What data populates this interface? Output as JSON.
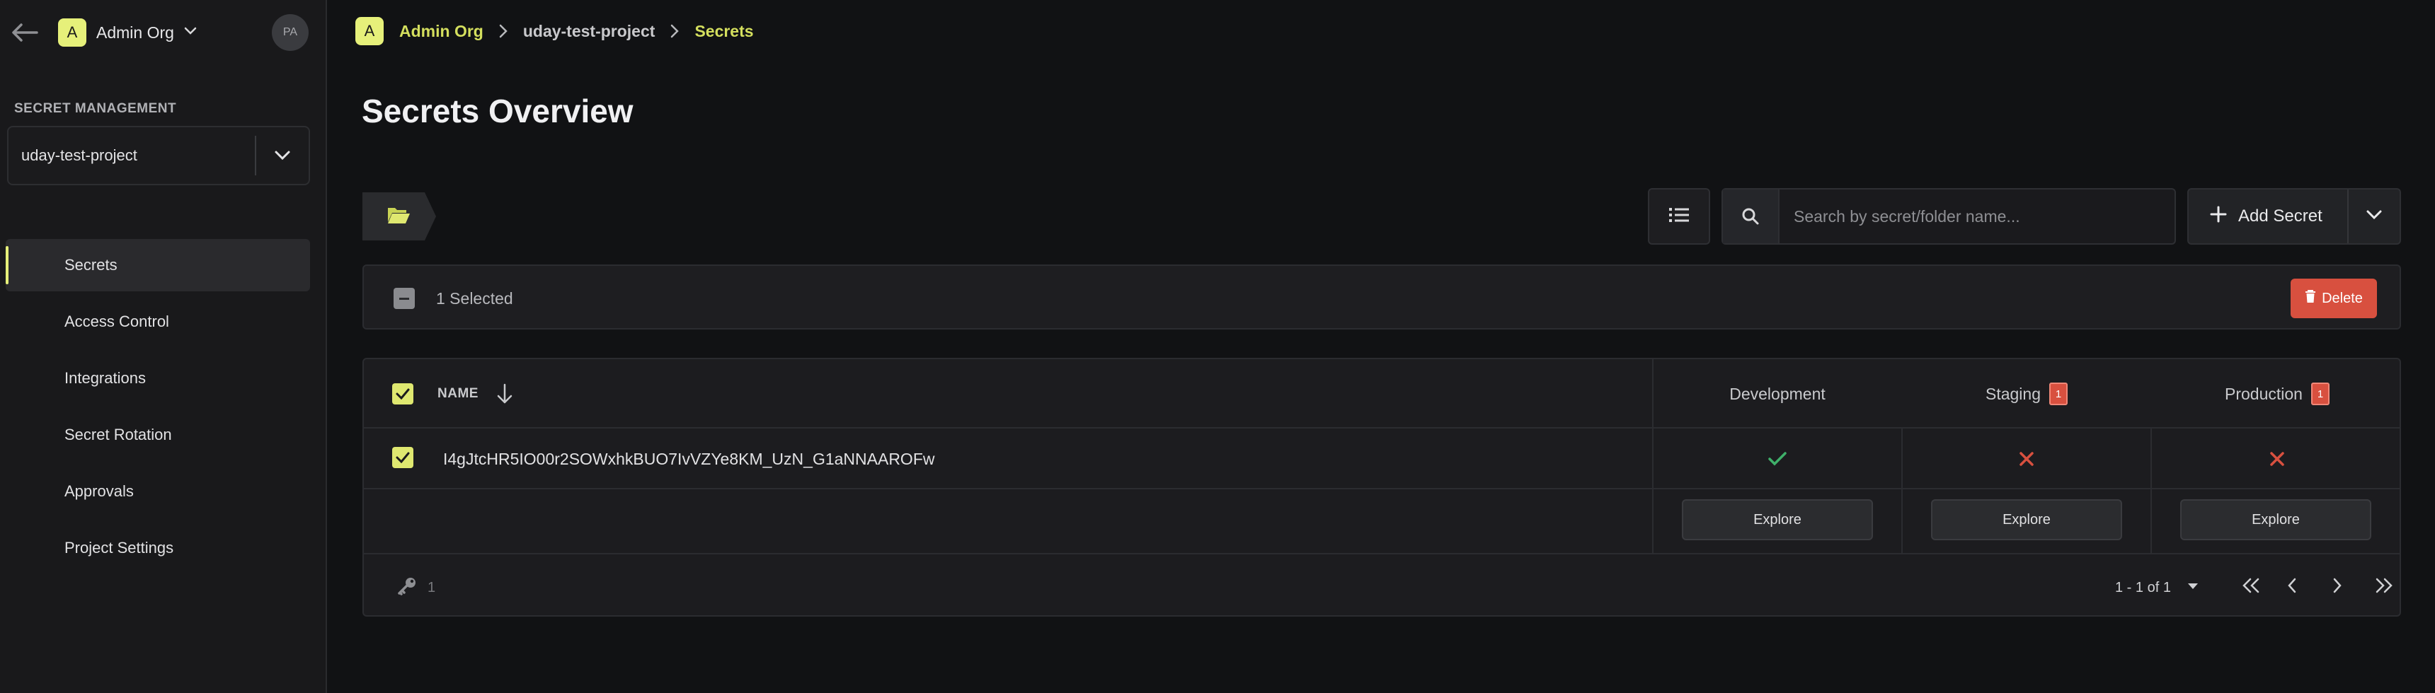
{
  "sidebar": {
    "org_badge": "A",
    "org_name": "Admin Org",
    "avatar_initials": "PA",
    "section_label": "SECRET MANAGEMENT",
    "project_select": "uday-test-project",
    "items": [
      {
        "label": "Secrets",
        "active": true
      },
      {
        "label": "Access Control"
      },
      {
        "label": "Integrations"
      },
      {
        "label": "Secret Rotation"
      },
      {
        "label": "Approvals"
      },
      {
        "label": "Project Settings"
      }
    ]
  },
  "breadcrumb": {
    "badge": "A",
    "org": "Admin Org",
    "project": "uday-test-project",
    "current": "Secrets"
  },
  "page_title": "Secrets Overview",
  "toolbar": {
    "search_placeholder": "Search by secret/folder name...",
    "search_value": "",
    "add_secret_label": "Add Secret"
  },
  "selection": {
    "selected_text": "1 Selected",
    "delete_label": "Delete"
  },
  "table": {
    "name_header": "NAME",
    "environments": [
      {
        "name": "Development",
        "badge": ""
      },
      {
        "name": "Staging",
        "badge": "1"
      },
      {
        "name": "Production",
        "badge": "1"
      }
    ],
    "rows": [
      {
        "name": "I4gJtcHR5IO00r2SOWxhkBUO7IvVZYe8KM_UzN_G1aNNAAROFw",
        "status": [
          "present",
          "missing",
          "missing"
        ]
      }
    ],
    "explore_label": "Explore",
    "footer": {
      "key_count": "1",
      "page_range": "1 - 1 of 1"
    }
  },
  "colors": {
    "accent": "#e6f07a",
    "danger": "#d8503f",
    "success": "#3fb06a"
  }
}
